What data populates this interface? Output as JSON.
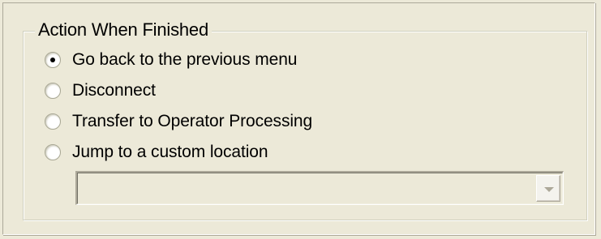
{
  "group": {
    "title": "Action When Finished"
  },
  "options": [
    {
      "label": "Go back to the previous menu",
      "checked": true
    },
    {
      "label": "Disconnect",
      "checked": false
    },
    {
      "label": "Transfer to Operator Processing",
      "checked": false
    },
    {
      "label": "Jump to a custom location",
      "checked": false
    }
  ],
  "custom_location": {
    "value": "",
    "enabled": false
  },
  "icons": {
    "dropdown": "chevron-down-icon"
  },
  "colors": {
    "background": "#ece9d8",
    "disabled_text": "#aca899"
  }
}
